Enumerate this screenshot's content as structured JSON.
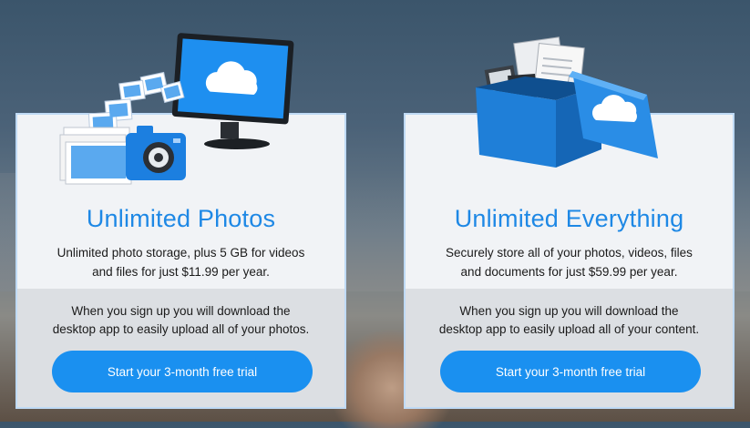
{
  "plans": [
    {
      "title": "Unlimited Photos",
      "description_line1": "Unlimited photo storage, plus 5 GB for videos",
      "description_line2": "and files for just $11.99 per year.",
      "note_line1": "When you sign up you will download the",
      "note_line2": "desktop app to easily upload all of your photos.",
      "cta_label": "Start your 3-month free trial",
      "illustration": "monitor-camera-photos-icon"
    },
    {
      "title": "Unlimited Everything",
      "description_line1": "Securely store all of your photos, videos, files",
      "description_line2": "and documents for just $59.99 per year.",
      "note_line1": "When you sign up you will download the",
      "note_line2": "desktop app to easily upload all of your content.",
      "cta_label": "Start your 3-month free trial",
      "illustration": "cloud-box-files-icon"
    }
  ],
  "colors": {
    "accent": "#1a90f0",
    "title": "#1e88e5",
    "card_border": "#bfdaf5",
    "card_upper": "#f1f3f6",
    "card_lower": "#dcdfe3"
  }
}
